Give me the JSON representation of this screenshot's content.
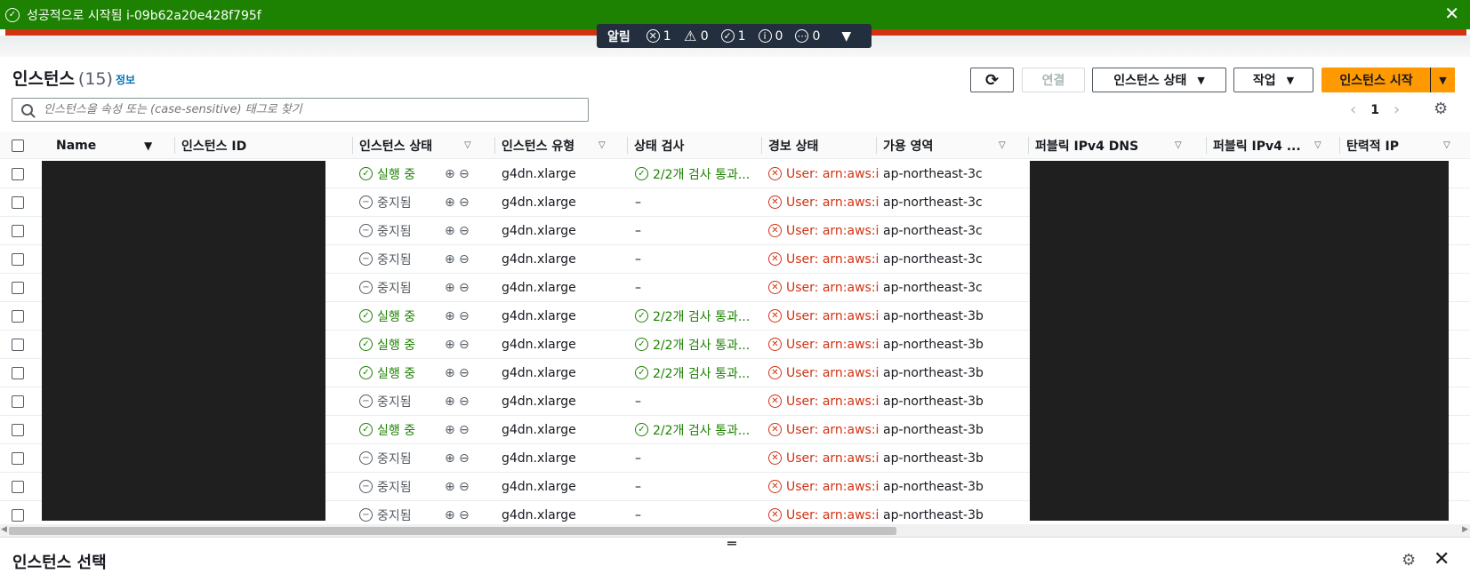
{
  "banner": {
    "message": "성공적으로 시작됨 i-09b62a20e428f795f",
    "close": "✕"
  },
  "notifications": {
    "label": "알림",
    "error_count": "1",
    "warning_count": "0",
    "success_count": "1",
    "info_count": "0",
    "progress_count": "0"
  },
  "header": {
    "title": "인스턴스",
    "count": "(15)",
    "info": "정보"
  },
  "toolbar": {
    "refresh": "⟳",
    "connect": "연결",
    "instance_state": "인스턴스 상태",
    "actions": "작업",
    "launch": "인스턴스 시작"
  },
  "search": {
    "placeholder": "인스턴스을 속성 또는 (case-sensitive) 태그로 찾기"
  },
  "pagination": {
    "page": "1"
  },
  "columns": {
    "name": "Name",
    "instance_id": "인스턴스 ID",
    "state": "인스턴스 상태",
    "type": "인스턴스 유형",
    "status_check": "상태 검사",
    "alarm": "경보 상태",
    "az": "가용 영역",
    "public_dns": "퍼블릭 IPv4 DNS",
    "public_ip": "퍼블릭 IPv4 ...",
    "elastic_ip": "탄력적 IP"
  },
  "rows": [
    {
      "state": "실행 중",
      "running": true,
      "type": "g4dn.xlarge",
      "check": "2/2개 검사 통과...",
      "alarm": "User: arn:aws:i",
      "az": "ap-northeast-3c"
    },
    {
      "state": "중지됨",
      "running": false,
      "type": "g4dn.xlarge",
      "check": "–",
      "alarm": "User: arn:aws:i",
      "az": "ap-northeast-3c"
    },
    {
      "state": "중지됨",
      "running": false,
      "type": "g4dn.xlarge",
      "check": "–",
      "alarm": "User: arn:aws:i",
      "az": "ap-northeast-3c"
    },
    {
      "state": "중지됨",
      "running": false,
      "type": "g4dn.xlarge",
      "check": "–",
      "alarm": "User: arn:aws:i",
      "az": "ap-northeast-3c"
    },
    {
      "state": "중지됨",
      "running": false,
      "type": "g4dn.xlarge",
      "check": "–",
      "alarm": "User: arn:aws:i",
      "az": "ap-northeast-3c"
    },
    {
      "state": "실행 중",
      "running": true,
      "type": "g4dn.xlarge",
      "check": "2/2개 검사 통과...",
      "alarm": "User: arn:aws:i",
      "az": "ap-northeast-3b"
    },
    {
      "state": "실행 중",
      "running": true,
      "type": "g4dn.xlarge",
      "check": "2/2개 검사 통과...",
      "alarm": "User: arn:aws:i",
      "az": "ap-northeast-3b"
    },
    {
      "state": "실행 중",
      "running": true,
      "type": "g4dn.xlarge",
      "check": "2/2개 검사 통과...",
      "alarm": "User: arn:aws:i",
      "az": "ap-northeast-3b"
    },
    {
      "state": "중지됨",
      "running": false,
      "type": "g4dn.xlarge",
      "check": "–",
      "alarm": "User: arn:aws:i",
      "az": "ap-northeast-3b"
    },
    {
      "state": "실행 중",
      "running": true,
      "type": "g4dn.xlarge",
      "check": "2/2개 검사 통과...",
      "alarm": "User: arn:aws:i",
      "az": "ap-northeast-3b"
    },
    {
      "state": "중지됨",
      "running": false,
      "type": "g4dn.xlarge",
      "check": "–",
      "alarm": "User: arn:aws:i",
      "az": "ap-northeast-3b"
    },
    {
      "state": "중지됨",
      "running": false,
      "type": "g4dn.xlarge",
      "check": "–",
      "alarm": "User: arn:aws:i",
      "az": "ap-northeast-3b"
    },
    {
      "state": "중지됨",
      "running": false,
      "type": "g4dn.xlarge",
      "check": "–",
      "alarm": "User: arn:aws:i",
      "az": "ap-northeast-3b"
    }
  ],
  "bottom_panel": {
    "title": "인스턴스 선택"
  },
  "colors": {
    "success": "#1d8102",
    "error": "#d13212",
    "primary": "#ff9900",
    "nav": "#232f3e"
  }
}
